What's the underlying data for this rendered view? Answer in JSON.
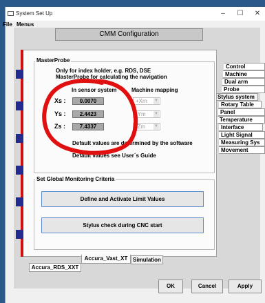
{
  "window": {
    "title": "System Set Up",
    "minimize": "–",
    "maximize": "☐",
    "close": "✕"
  },
  "menu": [
    "File",
    "Menus"
  ],
  "header": "CMM Configuration",
  "masterprobe": {
    "group_title": "MasterProbe",
    "desc1": "Only for index holder, e.g. RDS, DSE",
    "desc2": "MasterProbe for calculating the navigation",
    "col_sensor": "In sensor system",
    "col_machine": "Machine mapping",
    "rows": [
      {
        "label": "Xs :",
        "value": "0.0070",
        "mapping": "+Xm"
      },
      {
        "label": "Ys :",
        "value": "2.4423",
        "mapping": "-Ym"
      },
      {
        "label": "Zs :",
        "value": "7.4337",
        "mapping": "-Zm"
      }
    ],
    "note1": "Default values are determined by the software",
    "note2": "Default values see User´s Guide"
  },
  "monitoring": {
    "group_title": "Set Global Monitoring Criteria",
    "btn_limits": "Define and Activate Limit Values",
    "btn_stylus": "Stylus check during CNC start"
  },
  "side_tabs": [
    "Control",
    "Machine",
    "Dual arm",
    "Probe",
    "Stylus system",
    "Rotary Table",
    "Panel",
    "Temperature",
    "Interface",
    "Light Signal",
    "Measuring Sys",
    "Movement"
  ],
  "bottom_tabs": [
    "Accura_Vast_XT",
    "Simulation",
    "Accura_RDS_XXT"
  ],
  "footer": {
    "ok": "OK",
    "cancel": "Cancel",
    "apply": "Apply"
  },
  "colors": {
    "annotation": "#e01010",
    "marker": "#242b8e",
    "accent_bar": "#d01010"
  }
}
